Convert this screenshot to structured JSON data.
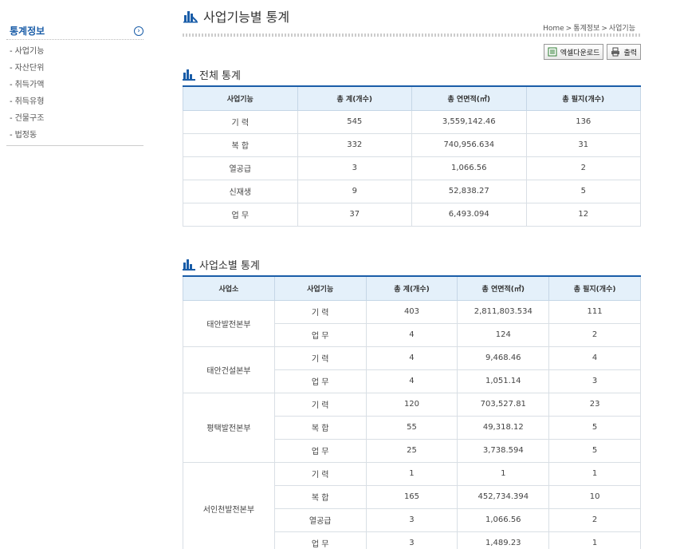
{
  "sidebar": {
    "title": "통계정보",
    "arrow": "›",
    "items": [
      {
        "label": "사업기능"
      },
      {
        "label": "자산단위"
      },
      {
        "label": "취득가액"
      },
      {
        "label": "취득유형"
      },
      {
        "label": "건물구조"
      },
      {
        "label": "법정동"
      }
    ]
  },
  "header": {
    "title": "사업기능별 통계",
    "breadcrumb": [
      "Home",
      "통계정보",
      "사업기능"
    ],
    "sep": ">"
  },
  "buttons": {
    "excel": "엑셀다운로드",
    "print": "출력"
  },
  "summary": {
    "title": "전체 통계",
    "headers": [
      "사업기능",
      "총 계(개수)",
      "총 연면적(㎡)",
      "총 필지(개수)"
    ],
    "rows": [
      [
        "기  력",
        "545",
        "3,559,142.46",
        "136"
      ],
      [
        "복  합",
        "332",
        "740,956.634",
        "31"
      ],
      [
        "열공급",
        "3",
        "1,066.56",
        "2"
      ],
      [
        "신재생",
        "9",
        "52,838.27",
        "5"
      ],
      [
        "업  무",
        "37",
        "6,493.094",
        "12"
      ]
    ]
  },
  "byOffice": {
    "title": "사업소별 통계",
    "headers": [
      "사업소",
      "사업기능",
      "총 계(개수)",
      "총 연면적(㎡)",
      "총 필지(개수)"
    ],
    "groups": [
      {
        "office": "태안발전본부",
        "rows": [
          [
            "기  력",
            "403",
            "2,811,803.534",
            "111"
          ],
          [
            "업  무",
            "4",
            "124",
            "2"
          ]
        ]
      },
      {
        "office": "태안건설본부",
        "rows": [
          [
            "기  력",
            "4",
            "9,468.46",
            "4"
          ],
          [
            "업  무",
            "4",
            "1,051.14",
            "3"
          ]
        ]
      },
      {
        "office": "평택발전본부",
        "rows": [
          [
            "기  력",
            "120",
            "703,527.81",
            "23"
          ],
          [
            "복  합",
            "55",
            "49,318.12",
            "5"
          ],
          [
            "업  무",
            "25",
            "3,738.594",
            "5"
          ]
        ]
      },
      {
        "office": "서인천발전본부",
        "rows": [
          [
            "기  력",
            "1",
            "1",
            "1"
          ],
          [
            "복  합",
            "165",
            "452,734.394",
            "10"
          ],
          [
            "열공급",
            "3",
            "1,066.56",
            "2"
          ],
          [
            "업  무",
            "3",
            "1,489.23",
            "1"
          ]
        ]
      }
    ]
  },
  "colors": {
    "accent": "#1a5da8",
    "header_bg": "#e4f0fa"
  }
}
